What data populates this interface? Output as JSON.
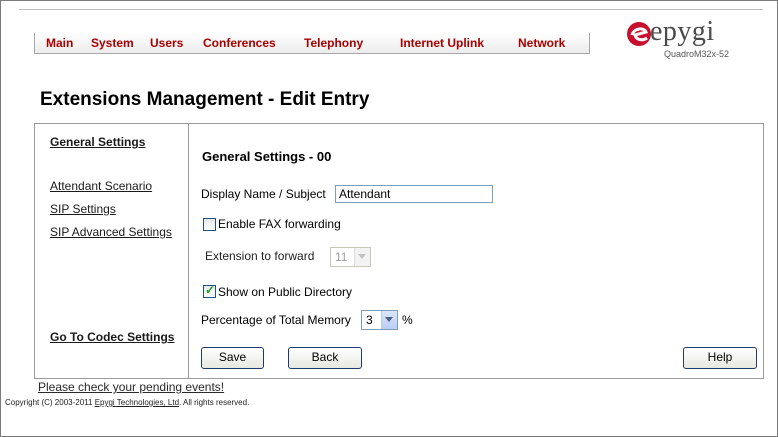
{
  "nav": {
    "items": [
      "Main",
      "System",
      "Users",
      "Conferences",
      "Telephony",
      "Internet Uplink",
      "Network"
    ]
  },
  "logo": {
    "text": "epygi",
    "model": "QuadroM32x-52",
    "icon": "epygi-swoosh-logo"
  },
  "page_title": "Extensions Management - Edit Entry",
  "sidebar": {
    "general_settings": "General Settings",
    "attendant_scenario": "Attendant Scenario",
    "sip_settings": "SIP Settings",
    "sip_advanced_settings": "SIP Advanced Settings",
    "go_to_codec": "Go To Codec Settings"
  },
  "main": {
    "section_title": "General Settings - 00",
    "display_name_label": "Display Name / Subject",
    "display_name_value": "Attendant",
    "fax_label": "Enable FAX forwarding",
    "fax_checked": false,
    "ext_forward_label": "Extension to forward",
    "ext_forward_value": "11",
    "public_dir_label": "Show on Public Directory",
    "public_dir_checked": true,
    "memory_label": "Percentage of Total Memory",
    "memory_value": "3",
    "memory_unit": "%"
  },
  "buttons": {
    "save": "Save",
    "back": "Back",
    "help": "Help"
  },
  "footer": {
    "pending": "Please check your pending events!",
    "copyright_pre": "Copyright (C) 2003-2011 ",
    "company": "Epygi Technologies, Ltd",
    "copyright_post": ". All rights reserved."
  },
  "colors": {
    "nav_text": "#a80000",
    "logo_red": "#c8102e",
    "check_green": "#21a121"
  }
}
